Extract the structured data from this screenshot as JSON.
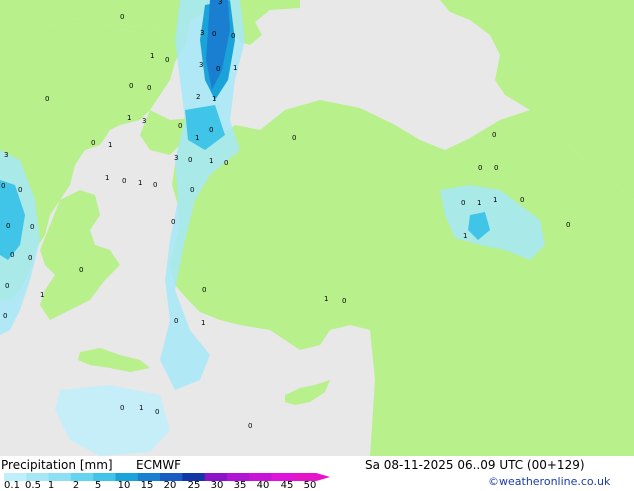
{
  "footer": {
    "title": "Precipitation [mm]",
    "model": "ECMWF",
    "valid_time": "Sa 08-11-2025 06..09 UTC (00+129)",
    "credit": "©weatheronline.co.uk"
  },
  "legend": {
    "ticks": [
      "0.1",
      "0.5",
      "1",
      "2",
      "5",
      "10",
      "15",
      "20",
      "25",
      "30",
      "35",
      "40",
      "45",
      "50"
    ],
    "colors": [
      "#bfeffa",
      "#a6e7f7",
      "#8cdff4",
      "#66d3ef",
      "#40c4e8",
      "#1aa3d9",
      "#1a7fd0",
      "#1a5bc4",
      "#1437a8",
      "#8c14c8",
      "#b014d4",
      "#c814d8",
      "#dc14dc",
      "#e614c8"
    ]
  },
  "map": {
    "land_color": "#b8f08c",
    "sea_color": "#e8e8e8",
    "values": [
      "3",
      "0",
      "3",
      "0",
      "0",
      "1",
      "0",
      "3",
      "0",
      "1",
      "0",
      "0",
      "1",
      "2",
      "0",
      "1",
      "3",
      "0",
      "0",
      "1",
      "0",
      "1",
      "3",
      "3",
      "0",
      "1",
      "0",
      "0",
      "0",
      "0",
      "0",
      "1",
      "0",
      "1",
      "0",
      "0",
      "0",
      "0",
      "0",
      "1",
      "0",
      "0",
      "1",
      "1",
      "0",
      "0",
      "0",
      "0",
      "0",
      "0",
      "0",
      "1",
      "0",
      "1",
      "0",
      "0",
      "0",
      "1",
      "0",
      "1",
      "0",
      "0"
    ]
  }
}
